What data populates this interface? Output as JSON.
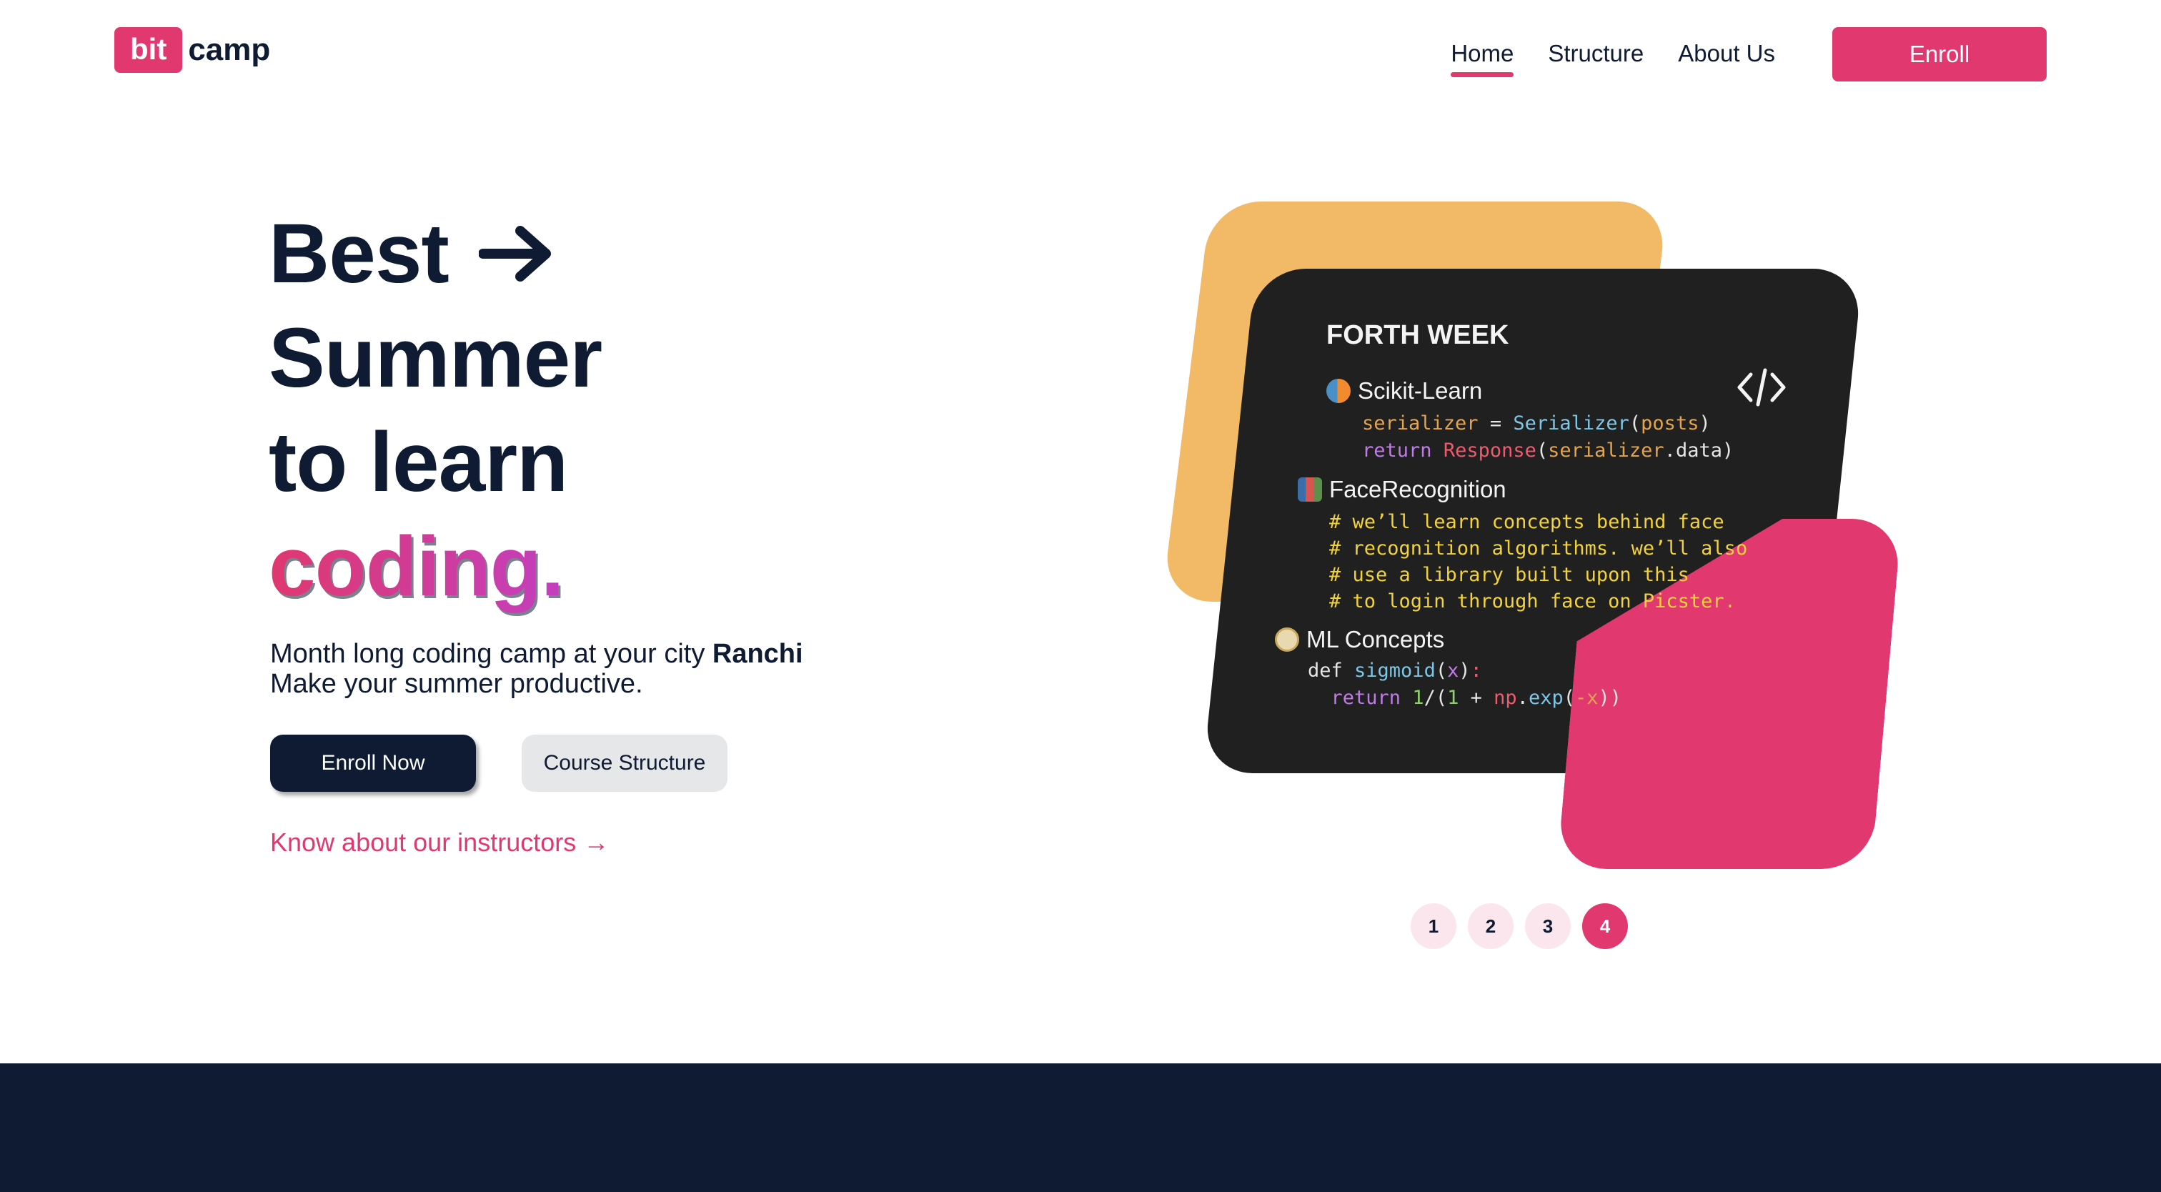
{
  "nav": {
    "logo_bit": "bit",
    "logo_camp": "camp",
    "links": [
      "Home",
      "Structure",
      "About Us"
    ],
    "enroll_label": "Enroll"
  },
  "hero": {
    "title_line1": "Best",
    "title_line2": "Summer",
    "title_line3": "to learn",
    "title_highlight": "coding.",
    "subtext_prefix": "Month long coding camp at your city ",
    "subtext_city": "Ranchi",
    "subtext_line2": "Make your summer productive.",
    "primary_button": "Enroll Now",
    "secondary_button": "Course Structure",
    "instructors_link": "Know about our instructors →"
  },
  "card": {
    "title": "FORTH WEEK",
    "sections": [
      {
        "name": "Scikit-Learn",
        "icon": "scikit-learn-icon"
      },
      {
        "name": "FaceRecognition",
        "icon": "books-icon"
      },
      {
        "name": "ML Concepts",
        "icon": "temple-icon"
      }
    ],
    "code_icon": "code-brackets-icon"
  },
  "pager": {
    "pages": [
      "1",
      "2",
      "3",
      "4"
    ],
    "active": "4"
  },
  "colors": {
    "brand_pink": "#e0386f",
    "navy": "#0e1b33",
    "orange": "#f2b967",
    "card_bg": "#202020"
  }
}
